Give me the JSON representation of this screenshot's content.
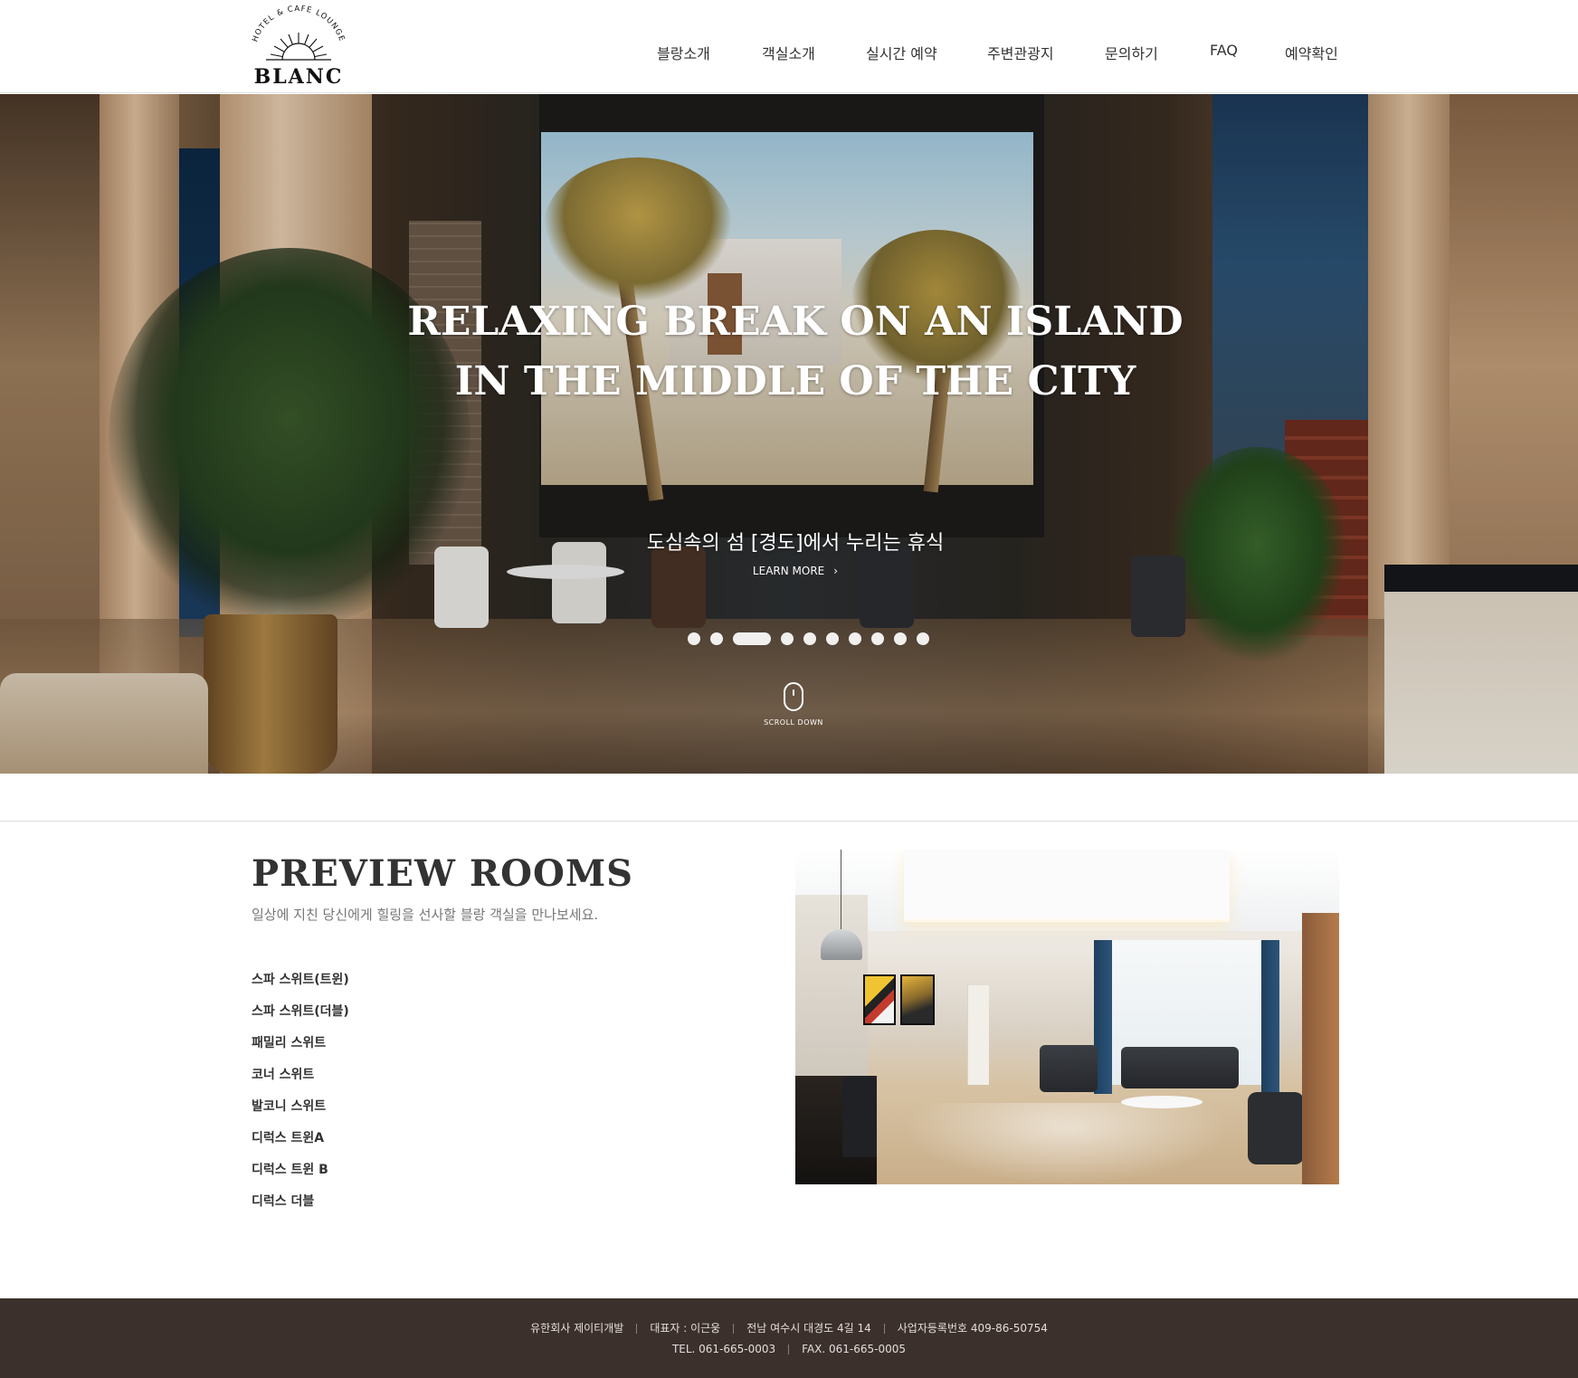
{
  "brand": {
    "arc_text": "HOTEL & CAFE LOUNGE",
    "name": "BLANC"
  },
  "nav": {
    "items": [
      {
        "id": "about",
        "label": "블랑소개"
      },
      {
        "id": "rooms",
        "label": "객실소개"
      },
      {
        "id": "reservation",
        "label": "실시간 예약"
      },
      {
        "id": "tour",
        "label": "주변관광지"
      },
      {
        "id": "contact",
        "label": "문의하기"
      },
      {
        "id": "faq",
        "label": "FAQ"
      },
      {
        "id": "check",
        "label": "예약확인"
      }
    ]
  },
  "hero": {
    "title_line1": "RELAXING BREAK ON AN ISLAND",
    "title_line2": "IN THE MIDDLE OF THE CITY",
    "subtitle": "도심속의 섬 [경도]에서 누리는 휴식",
    "learn_more": "LEARN MORE",
    "slide_count": 10,
    "active_slide": 3,
    "scroll_label": "SCROLL DOWN"
  },
  "preview": {
    "title": "PREVIEW ROOMS",
    "subtitle": "일상에 지친 당신에게 힐링을 선사할 블랑 객실을 만나보세요.",
    "rooms": [
      "스파 스위트(트윈)",
      "스파 스위트(더블)",
      "패밀리 스위트",
      "코너 스위트",
      "발코니 스위트",
      "디럭스 트윈A",
      "디럭스 트윈 B",
      "디럭스 더블"
    ]
  },
  "footer": {
    "company": "유한회사 제이티개발",
    "ceo": "대표자 : 이근웅",
    "address": "전남 여수시 대경도 4길 14",
    "biz_no": "사업자등록번호 409-86-50754",
    "tel": "TEL. 061-665-0003",
    "fax": "FAX. 061-665-0005"
  },
  "colors": {
    "footer_bg": "#3b302c",
    "header_bg": "#ffffff",
    "text_dark": "#333333"
  }
}
